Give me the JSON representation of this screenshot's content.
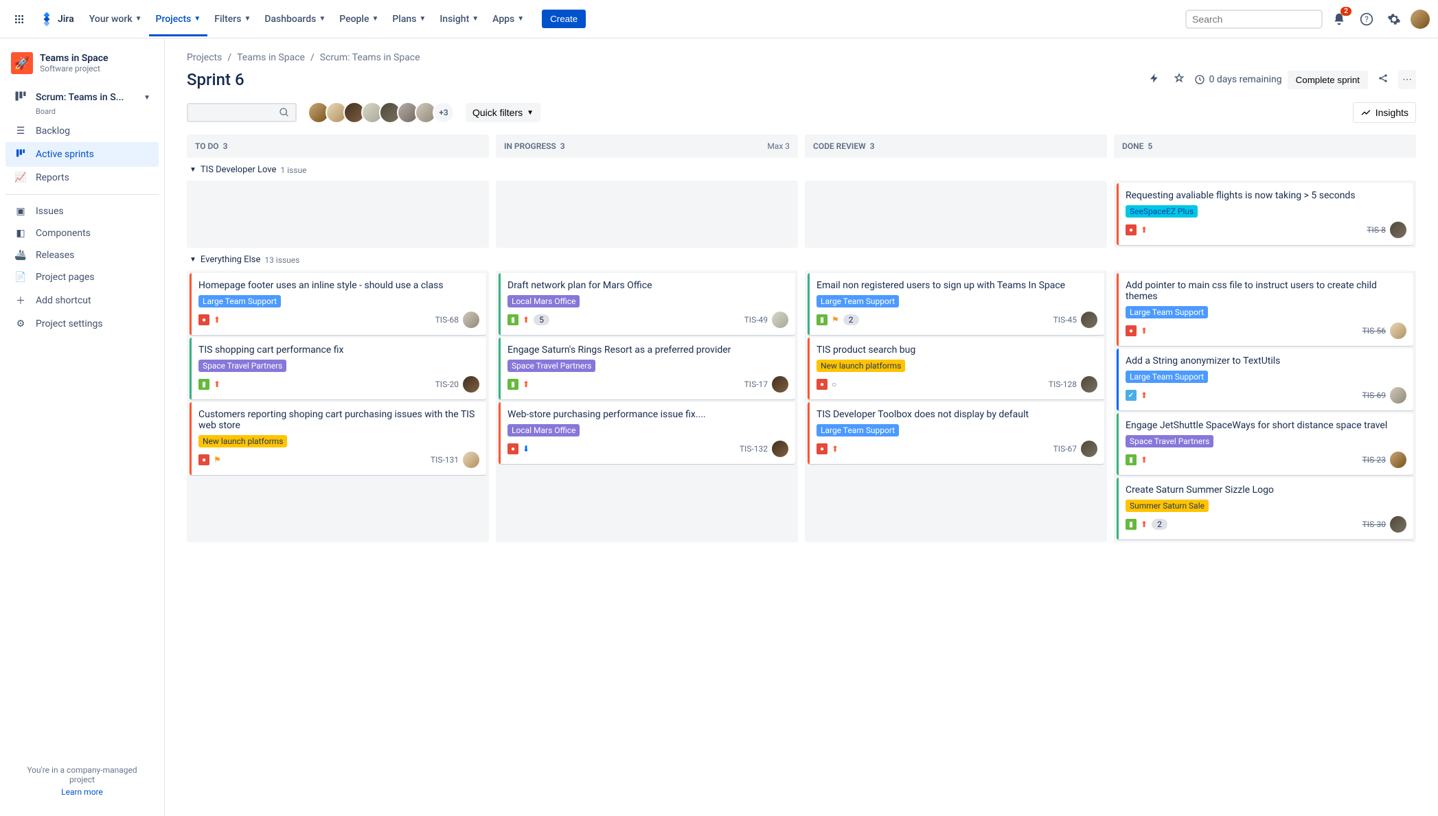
{
  "topnav": {
    "logo": "Jira",
    "items": [
      "Your work",
      "Projects",
      "Filters",
      "Dashboards",
      "People",
      "Plans",
      "Insight",
      "Apps"
    ],
    "create": "Create",
    "search_placeholder": "Search",
    "notification_count": "2"
  },
  "sidebar": {
    "project_name": "Teams in Space",
    "project_type": "Software project",
    "board_name": "Scrum: Teams in S...",
    "board_label": "Board",
    "items": {
      "backlog": "Backlog",
      "active": "Active sprints",
      "reports": "Reports",
      "issues": "Issues",
      "components": "Components",
      "releases": "Releases",
      "pages": "Project pages",
      "shortcut": "Add shortcut",
      "settings": "Project settings"
    },
    "footer_line": "You're in a company-managed project",
    "footer_link": "Learn more"
  },
  "breadcrumb": [
    "Projects",
    "Teams in Space",
    "Scrum: Teams in Space"
  ],
  "page_title": "Sprint 6",
  "head": {
    "days_remaining": "0 days remaining",
    "complete": "Complete sprint",
    "quick_filters": "Quick filters",
    "avatar_more": "+3",
    "insights": "Insights"
  },
  "columns": [
    {
      "name": "TO DO",
      "count": "3",
      "max": ""
    },
    {
      "name": "IN PROGRESS",
      "count": "3",
      "max": "Max 3"
    },
    {
      "name": "CODE REVIEW",
      "count": "3",
      "max": ""
    },
    {
      "name": "DONE",
      "count": "5",
      "max": ""
    }
  ],
  "swimlanes": [
    {
      "name": "TIS Developer Love",
      "issue_count": "1 issue",
      "cols": [
        [],
        [],
        [],
        [
          {
            "type": "bug",
            "title": "Requesting avaliable flights is now taking > 5 seconds",
            "epic": "SeeSpaceEZ Plus",
            "epic_color": "teal",
            "key": "TIS-8",
            "prio": "highest",
            "avatar": "a5",
            "done": true
          }
        ]
      ]
    },
    {
      "name": "Everything Else",
      "issue_count": "13 issues",
      "cols": [
        [
          {
            "type": "bug",
            "title": "Homepage footer uses an inline style - should use a class",
            "epic": "Large Team Support",
            "epic_color": "blue",
            "key": "TIS-68",
            "prio": "highest",
            "avatar": "a7"
          },
          {
            "type": "story",
            "title": "TIS shopping cart performance fix",
            "epic": "Space Travel Partners",
            "epic_color": "purple",
            "key": "TIS-20",
            "prio": "highest",
            "avatar": "a3"
          },
          {
            "type": "bug",
            "title": "Customers reporting shoping cart purchasing issues with the TIS web store",
            "epic": "New launch platforms",
            "epic_color": "yellow",
            "key": "TIS-131",
            "prio": "",
            "flag": true,
            "avatar": "a2"
          }
        ],
        [
          {
            "type": "story",
            "title": "Draft network plan for Mars Office",
            "epic": "Local Mars Office",
            "epic_color": "purple",
            "key": "TIS-49",
            "prio": "highest",
            "sp": "5",
            "avatar": "a4"
          },
          {
            "type": "story",
            "title": "Engage Saturn's Rings Resort as a preferred provider",
            "epic": "Space Travel Partners",
            "epic_color": "purple",
            "key": "TIS-17",
            "prio": "highest",
            "avatar": "a3"
          },
          {
            "type": "bug",
            "title": "Web-store purchasing performance issue fix....",
            "epic": "Local Mars Office",
            "epic_color": "purple",
            "key": "TIS-132",
            "prio": "low",
            "avatar": "a3"
          }
        ],
        [
          {
            "type": "story",
            "title": "Email non registered users to sign up with Teams In Space",
            "epic": "Large Team Support",
            "epic_color": "blue",
            "key": "TIS-45",
            "prio": "",
            "flag": true,
            "sp": "2",
            "avatar": "a5"
          },
          {
            "type": "bug",
            "title": "TIS product search bug",
            "epic": "New launch platforms",
            "epic_color": "yellow",
            "key": "TIS-128",
            "prio": "none",
            "avatar": "a5"
          },
          {
            "type": "bug",
            "title": "TIS Developer Toolbox does not display by default",
            "epic": "Large Team Support",
            "epic_color": "blue",
            "key": "TIS-67",
            "prio": "highest",
            "avatar": "a5"
          }
        ],
        [
          {
            "type": "bug",
            "title": "Add pointer to main css file to instruct users to create child themes",
            "epic": "Large Team Support",
            "epic_color": "blue",
            "key": "TIS-56",
            "prio": "highest",
            "avatar": "a2",
            "done": true
          },
          {
            "type": "task",
            "title": "Add a String anonymizer to TextUtils",
            "epic": "Large Team Support",
            "epic_color": "blue",
            "key": "TIS-69",
            "prio": "highest",
            "avatar": "a7",
            "done": true
          },
          {
            "type": "story",
            "title": "Engage JetShuttle SpaceWays for short distance space travel",
            "epic": "Space Travel Partners",
            "epic_color": "purple",
            "key": "TIS-23",
            "prio": "highest",
            "avatar": "a1",
            "done": true
          },
          {
            "type": "story",
            "title": "Create Saturn Summer Sizzle Logo",
            "epic": "Summer Saturn Sale",
            "epic_color": "yellow",
            "key": "TIS-30",
            "prio": "highest",
            "sp": "2",
            "avatar": "a5",
            "done": true
          }
        ]
      ]
    }
  ]
}
